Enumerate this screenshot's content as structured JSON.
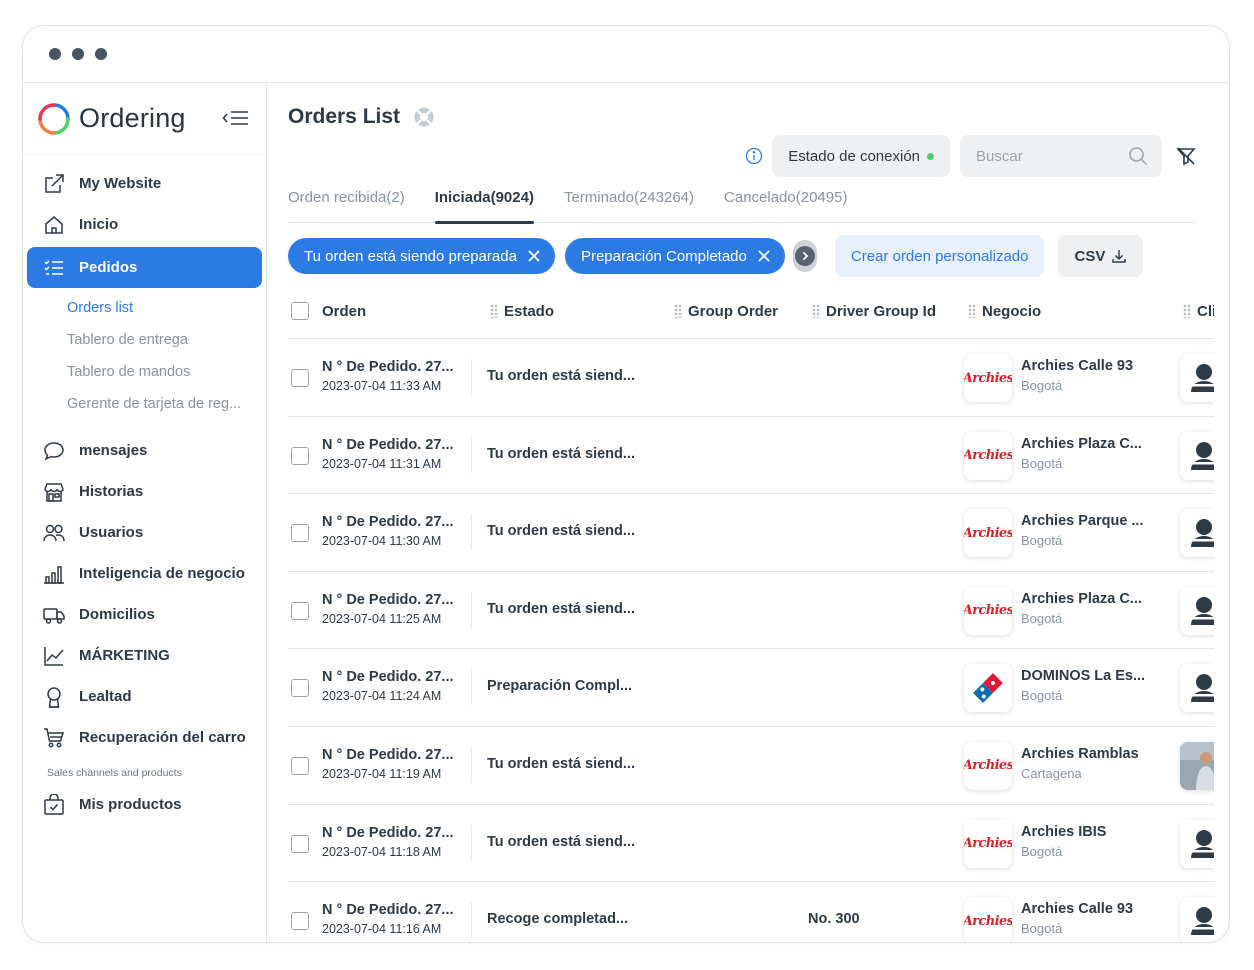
{
  "brand": {
    "name": "Ordering"
  },
  "sidebar": {
    "items": [
      {
        "label": "My Website",
        "icon": "external-link-icon"
      },
      {
        "label": "Inicio",
        "icon": "home-icon"
      },
      {
        "label": "Pedidos",
        "icon": "list-icon",
        "active": true
      },
      {
        "label": "mensajes",
        "icon": "chat-icon"
      },
      {
        "label": "Historias",
        "icon": "store-icon"
      },
      {
        "label": "Usuarios",
        "icon": "users-icon"
      },
      {
        "label": "Inteligencia de negocio",
        "icon": "bar-chart-icon"
      },
      {
        "label": "Domicilios",
        "icon": "truck-icon"
      },
      {
        "label": "MÁRKETING",
        "icon": "line-chart-icon"
      },
      {
        "label": "Lealtad",
        "icon": "award-icon"
      },
      {
        "label": "Recuperación del carro",
        "icon": "cart-icon"
      },
      {
        "label": "Mis productos",
        "icon": "bag-icon"
      }
    ],
    "subitems": [
      {
        "label": "Orders list",
        "active": true
      },
      {
        "label": "Tablero de entrega"
      },
      {
        "label": "Tablero de mandos"
      },
      {
        "label": "Gerente de tarjeta de reg..."
      }
    ],
    "section_label": "Sales channels and products"
  },
  "header": {
    "title": "Orders List",
    "connection_label": "Estado de conexión",
    "connection_color": "#4ccf66",
    "search_placeholder": "Buscar"
  },
  "tabs": [
    {
      "label": "Orden recibida(2)"
    },
    {
      "label": "Iniciada(9024)",
      "active": true
    },
    {
      "label": "Terminado(243264)"
    },
    {
      "label": "Cancelado(20495)"
    }
  ],
  "filters": {
    "chips": [
      "Tu orden está siendo preparada",
      "Preparación Completado"
    ],
    "custom_order_label": "Crear orden personalizado",
    "csv_label": "CSV"
  },
  "table": {
    "columns": [
      "Orden",
      "Estado",
      "Group Order",
      "Driver Group Id",
      "Negocio",
      "Cli"
    ],
    "rows": [
      {
        "order": "N ° De Pedido. 27...",
        "date": "2023-07-04 11:33 AM",
        "status": "Tu orden está siend...",
        "group": "",
        "business": "Archies Calle 93",
        "city": "Bogotá",
        "logo": "archies"
      },
      {
        "order": "N ° De Pedido. 27...",
        "date": "2023-07-04 11:31 AM",
        "status": "Tu orden está siend...",
        "group": "",
        "business": "Archies Plaza C...",
        "city": "Bogotá",
        "logo": "archies"
      },
      {
        "order": "N ° De Pedido. 27...",
        "date": "2023-07-04 11:30 AM",
        "status": "Tu orden está siend...",
        "group": "",
        "business": "Archies Parque ...",
        "city": "Bogotá",
        "logo": "archies"
      },
      {
        "order": "N ° De Pedido. 27...",
        "date": "2023-07-04 11:25 AM",
        "status": "Tu orden está siend...",
        "group": "",
        "business": "Archies Plaza C...",
        "city": "Bogotá",
        "logo": "archies"
      },
      {
        "order": "N ° De Pedido. 27...",
        "date": "2023-07-04 11:24 AM",
        "status": "Preparación Compl...",
        "group": "",
        "business": "DOMINOS La Es...",
        "city": "Bogotá",
        "logo": "dominos"
      },
      {
        "order": "N ° De Pedido. 27...",
        "date": "2023-07-04 11:19 AM",
        "status": "Tu orden está siend...",
        "group": "",
        "business": "Archies Ramblas",
        "city": "Cartagena",
        "logo": "archies",
        "avatar": "photo"
      },
      {
        "order": "N ° De Pedido. 27...",
        "date": "2023-07-04 11:18 AM",
        "status": "Tu orden está siend...",
        "group": "",
        "business": "Archies IBIS",
        "city": "Bogotá",
        "logo": "archies"
      },
      {
        "order": "N ° De Pedido. 27...",
        "date": "2023-07-04 11:16 AM",
        "status": "Recoge completad...",
        "group": "No. 300",
        "business": "Archies Calle 93",
        "city": "Bogotá",
        "logo": "archies"
      }
    ],
    "logo_text": {
      "archies": "Archies"
    }
  },
  "colors": {
    "accent": "#2c7be5",
    "archies_red": "#d8232a",
    "dominos_blue": "#0a6cb3",
    "dominos_red": "#e31837"
  }
}
